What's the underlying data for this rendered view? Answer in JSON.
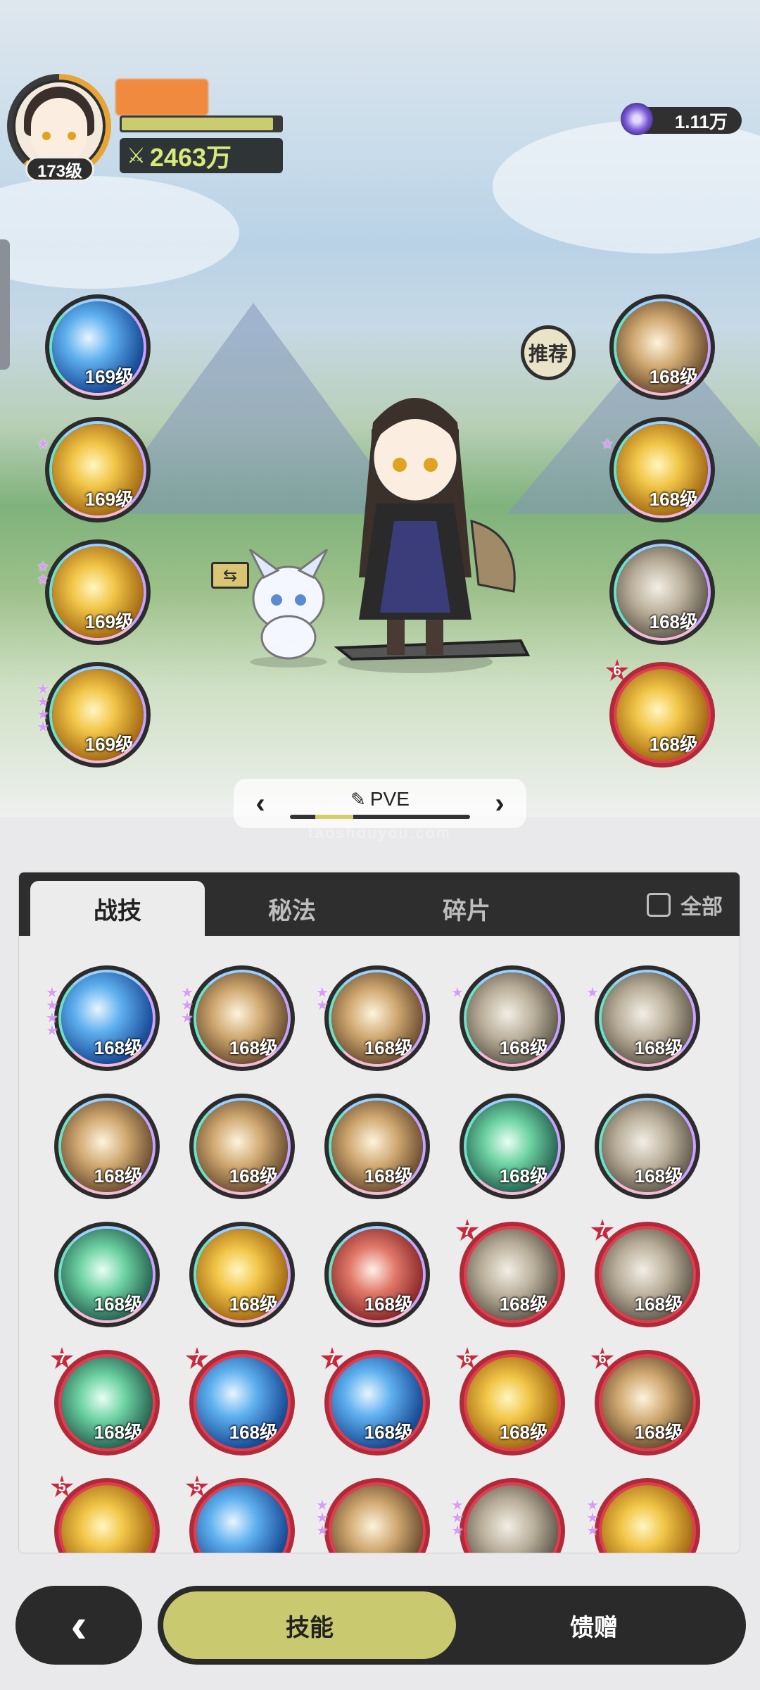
{
  "header": {
    "player_level": "173级",
    "combat_power": "2463万",
    "exp_fraction": 0.95,
    "currency_value": "1.11万"
  },
  "equipped_left": [
    {
      "level": "169级",
      "stars": 0,
      "art": "water"
    },
    {
      "level": "169级",
      "stars": 1,
      "art": "gold"
    },
    {
      "level": "169级",
      "stars": 2,
      "art": "gold"
    },
    {
      "level": "169级",
      "stars": 4,
      "art": "gold"
    }
  ],
  "equipped_right": [
    {
      "level": "168级",
      "stars": 0,
      "badge": "",
      "art": "bronze"
    },
    {
      "level": "168级",
      "stars": 1,
      "badge": "",
      "art": "gold"
    },
    {
      "level": "168级",
      "stars": 0,
      "badge": "",
      "art": "stone"
    },
    {
      "level": "168级",
      "stars": 0,
      "badge": "6",
      "art": "gold",
      "red": true
    }
  ],
  "recommend_label": "推荐",
  "loadout": {
    "label": "PVE",
    "prev": "‹",
    "next": "›"
  },
  "watermark": "taoshouyou.com",
  "panel": {
    "tabs": [
      "战技",
      "秘法",
      "碎片"
    ],
    "active_tab": 0,
    "all_label": "全部",
    "items": [
      {
        "level": "168级",
        "stars": 4,
        "badge": "",
        "art": "water"
      },
      {
        "level": "168级",
        "stars": 3,
        "badge": "",
        "art": "bronze"
      },
      {
        "level": "168级",
        "stars": 2,
        "badge": "",
        "art": "bronze"
      },
      {
        "level": "168级",
        "stars": 1,
        "badge": "",
        "art": "stone"
      },
      {
        "level": "168级",
        "stars": 1,
        "badge": "",
        "art": "stone"
      },
      {
        "level": "168级",
        "stars": 0,
        "badge": "",
        "art": "bronze"
      },
      {
        "level": "168级",
        "stars": 0,
        "badge": "",
        "art": "bronze"
      },
      {
        "level": "168级",
        "stars": 0,
        "badge": "",
        "art": "bronze"
      },
      {
        "level": "168级",
        "stars": 0,
        "badge": "",
        "art": "green"
      },
      {
        "level": "168级",
        "stars": 0,
        "badge": "",
        "art": "stone"
      },
      {
        "level": "168级",
        "stars": 0,
        "badge": "",
        "art": "green"
      },
      {
        "level": "168级",
        "stars": 0,
        "badge": "",
        "art": "gold"
      },
      {
        "level": "168级",
        "stars": 0,
        "badge": "",
        "art": "redglow"
      },
      {
        "level": "168级",
        "stars": 0,
        "badge": "7",
        "art": "stone",
        "red": true
      },
      {
        "level": "168级",
        "stars": 0,
        "badge": "7",
        "art": "stone",
        "red": true
      },
      {
        "level": "168级",
        "stars": 0,
        "badge": "7",
        "art": "green",
        "red": true
      },
      {
        "level": "168级",
        "stars": 0,
        "badge": "7",
        "art": "water",
        "red": true
      },
      {
        "level": "168级",
        "stars": 0,
        "badge": "7",
        "art": "water",
        "red": true
      },
      {
        "level": "168级",
        "stars": 0,
        "badge": "6",
        "art": "gold",
        "red": true
      },
      {
        "level": "168级",
        "stars": 0,
        "badge": "6",
        "art": "bronze",
        "red": true
      },
      {
        "level": "",
        "stars": 0,
        "badge": "5",
        "art": "gold",
        "red": true
      },
      {
        "level": "",
        "stars": 0,
        "badge": "5",
        "art": "water",
        "red": true
      },
      {
        "level": "",
        "stars": 3,
        "badge": "",
        "art": "bronze",
        "red": true
      },
      {
        "level": "",
        "stars": 3,
        "badge": "",
        "art": "stone",
        "red": true
      },
      {
        "level": "",
        "stars": 3,
        "badge": "",
        "art": "gold",
        "red": true
      }
    ]
  },
  "bottom": {
    "back": "‹",
    "skills": "技能",
    "gift": "馈赠"
  }
}
